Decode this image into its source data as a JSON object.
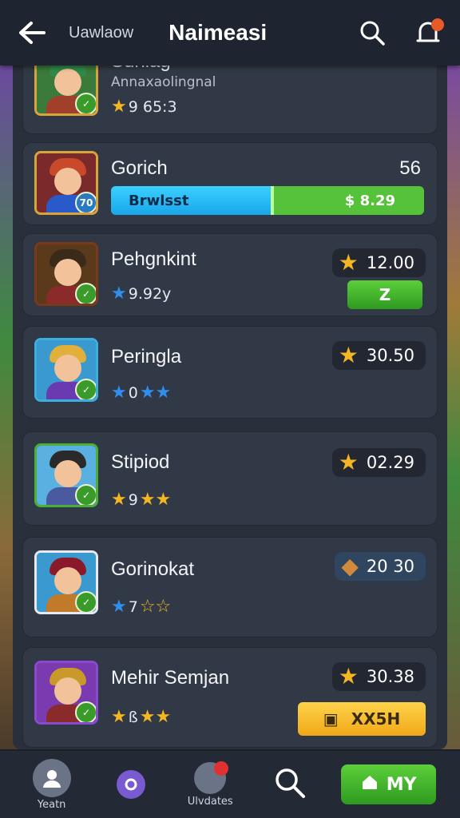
{
  "header": {
    "sub_title": "Uawlaow",
    "title": "Naimeasi"
  },
  "characters": [
    {
      "name": "Sunlag",
      "subtitle": "Annaxaolingnal",
      "rating": "9 65:3",
      "star_color": "gold",
      "stars_extra": "",
      "palette": {
        "bg": "#3a7a3a",
        "hat": "#2f8a4a",
        "body": "#a0402a"
      }
    },
    {
      "name": "Gorich",
      "level_text": "56",
      "progress_label": "Brwlsst",
      "progress_value": "$ 8.29",
      "progress_fraction": 0.5,
      "palette": {
        "bg": "#7a2a2a",
        "hat": "#c94a2a",
        "body": "#2a5ac9"
      }
    },
    {
      "name": "Pehgnkint",
      "rating": "9.92y",
      "star_color": "blue",
      "price": "12.00",
      "button": "Z",
      "palette": {
        "bg": "#5a3a1a",
        "hat": "#3a2a1a",
        "body": "#8a2a2a"
      }
    },
    {
      "name": "Peringla",
      "rating": "0",
      "star_color": "blue",
      "stars_extra": "★★",
      "price": "30.50",
      "palette": {
        "bg": "#3a9ad0",
        "hat": "#e0b03a",
        "body": "#6a3ab0"
      }
    },
    {
      "name": "Stipiod",
      "rating": "9",
      "star_color": "gold",
      "stars_extra": "★★",
      "price": "02.29",
      "palette": {
        "bg": "#5ab0e0",
        "hat": "#2a2a2a",
        "body": "#4a5aa0"
      }
    },
    {
      "name": "Gorinokat",
      "rating": "7",
      "star_color": "blue",
      "stars_extra": "☆☆",
      "price": "20 30",
      "palette": {
        "bg": "#3a9ad0",
        "hat": "#8a1a2a",
        "body": "#c07a2a"
      }
    },
    {
      "name": "Mehir Semjan",
      "rating": "ß",
      "star_color": "gold",
      "stars_extra": "★★",
      "price": "30.38",
      "button": "XX5H",
      "palette": {
        "bg": "#7a3ab0",
        "hat": "#c99a2a",
        "body": "#8a2a2a"
      }
    }
  ],
  "bottom_nav": {
    "profile_label": "Yeatn",
    "updates_label": "Ulvdates",
    "play_label": "MY"
  }
}
